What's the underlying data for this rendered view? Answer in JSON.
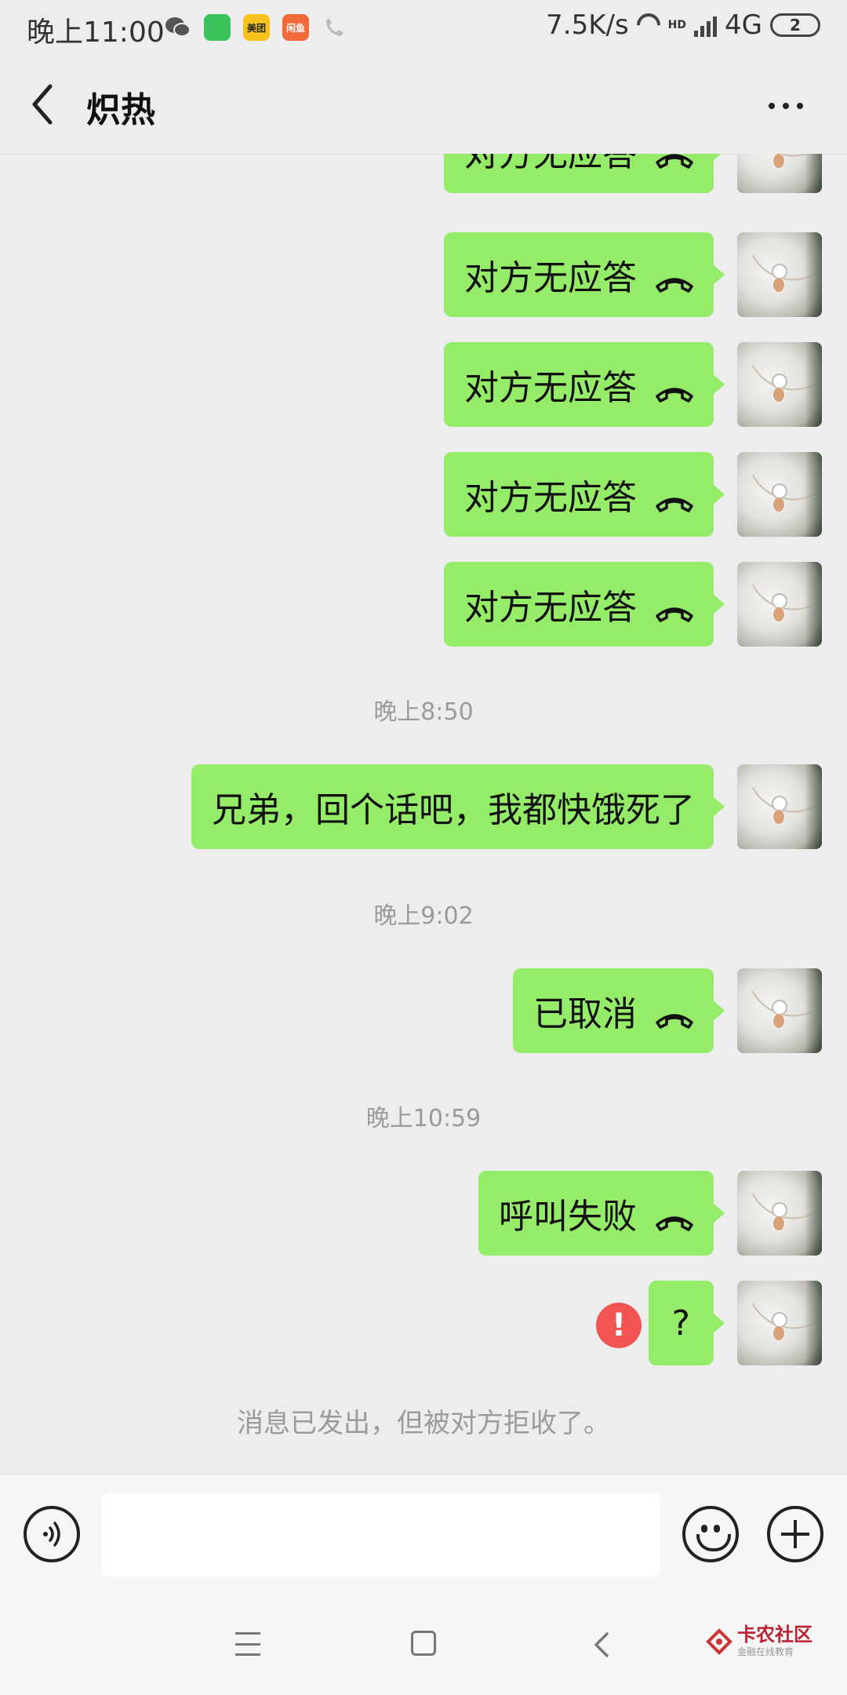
{
  "status_bar": {
    "time": "晚上11:00",
    "apps": [
      "wechat-icon",
      "green-app-icon",
      "美团",
      "闲鱼",
      "call-transfer-icon"
    ],
    "net_speed": "7.5K/s",
    "network": "4G",
    "hd_label": "HD",
    "battery_badge": "2"
  },
  "header": {
    "title": "炽热"
  },
  "messages": [
    {
      "type": "call",
      "text": "对方无应答"
    },
    {
      "type": "call",
      "text": "对方无应答"
    },
    {
      "type": "call",
      "text": "对方无应答"
    },
    {
      "type": "call",
      "text": "对方无应答"
    },
    {
      "type": "call",
      "text": "对方无应答"
    },
    {
      "type": "time",
      "text": "晚上8:50"
    },
    {
      "type": "text",
      "text": "兄弟，回个话吧，我都快饿死了"
    },
    {
      "type": "time",
      "text": "晚上9:02"
    },
    {
      "type": "call",
      "text": "已取消"
    },
    {
      "type": "time",
      "text": "晚上10:59"
    },
    {
      "type": "call",
      "text": "呼叫失败"
    },
    {
      "type": "text",
      "text": "?",
      "failed": true
    },
    {
      "type": "system",
      "text": "消息已发出，但被对方拒收了。"
    }
  ],
  "input": {
    "value": "",
    "placeholder": ""
  },
  "watermark": {
    "title": "卡农社区",
    "subtitle": "金融在线教育"
  },
  "colors": {
    "bubble": "#95ec69",
    "background": "#ededed",
    "error": "#f25353"
  }
}
